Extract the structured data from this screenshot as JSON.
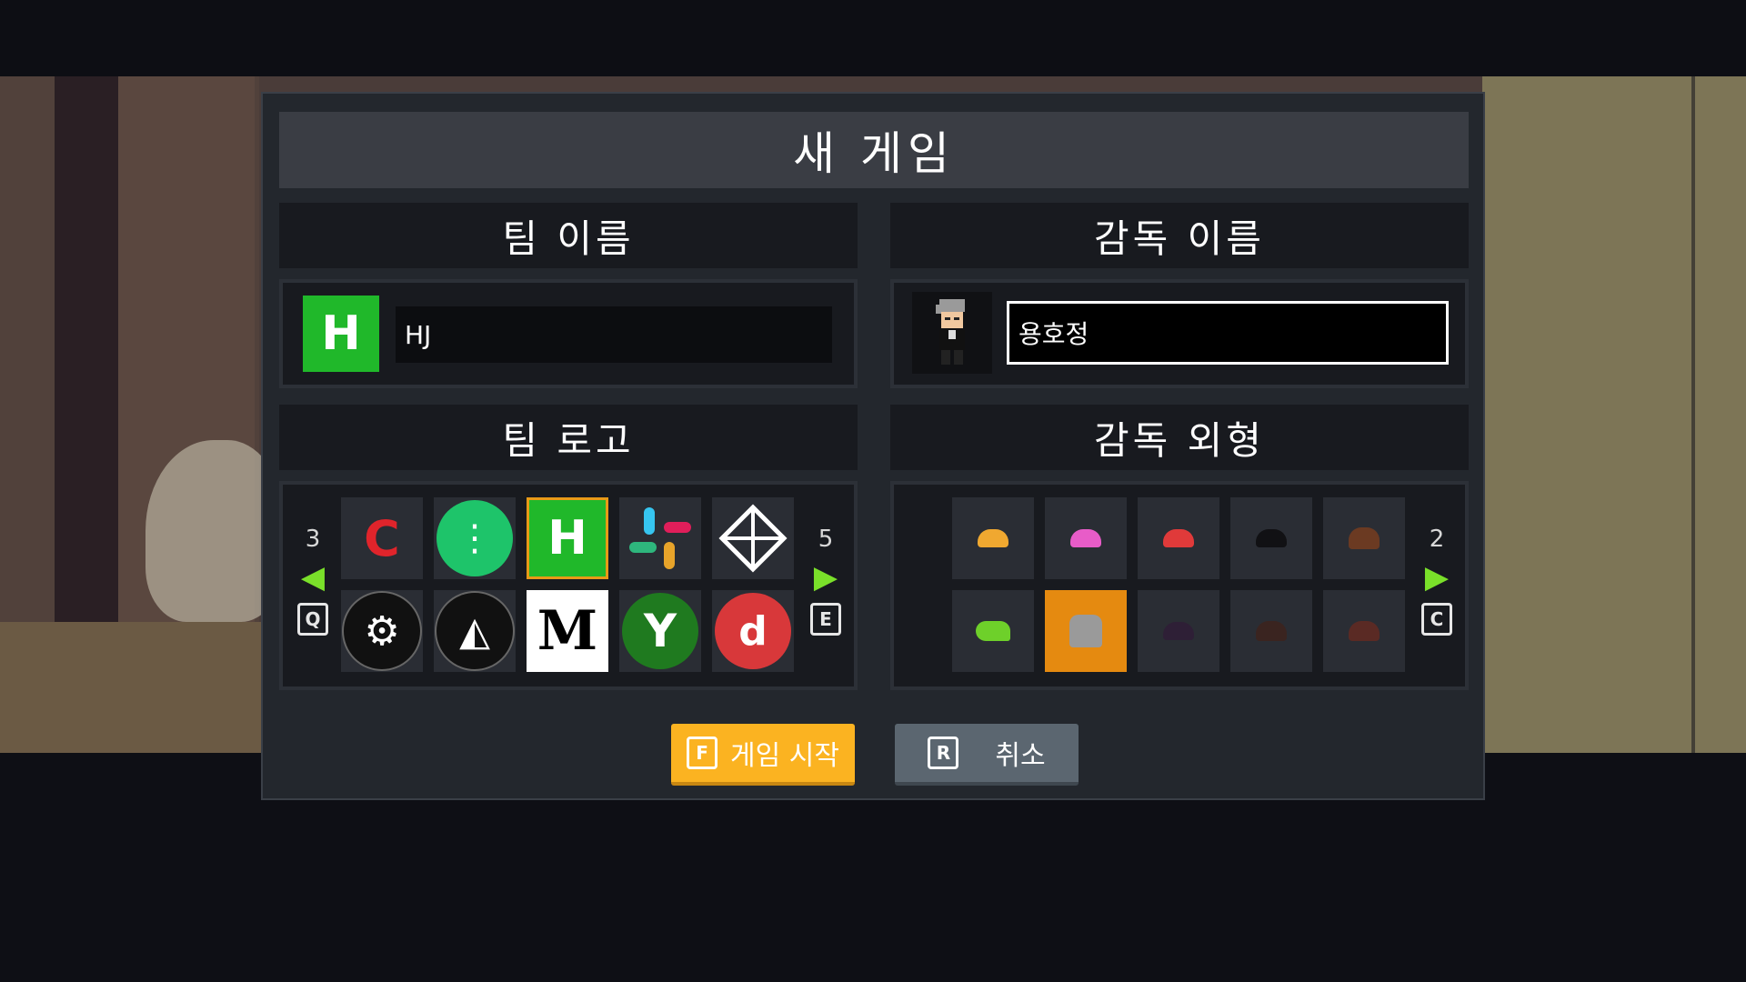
{
  "dialog": {
    "title": "새 게임",
    "team_name": {
      "header": "팀 이름",
      "icon_letter": "H",
      "value": "HJ"
    },
    "coach_name": {
      "header": "감독 이름",
      "value": "용호정"
    },
    "team_logo": {
      "header": "팀 로고",
      "prev_page": "3",
      "next_page": "5",
      "prev_key": "Q",
      "next_key": "E",
      "logos": [
        {
          "icon": "red-c-logo-icon",
          "glyph": "C",
          "color": "#e0242b"
        },
        {
          "icon": "green-circle-logo-icon",
          "glyph": "⋮",
          "color": "#1ec46a"
        },
        {
          "icon": "green-h-logo-icon",
          "glyph": "H",
          "color": "#20b82a",
          "selected": true
        },
        {
          "icon": "hashtag-logo-icon",
          "glyph": "#",
          "color": "#e8a42a"
        },
        {
          "icon": "triangle-logo-icon",
          "glyph": "◇",
          "color": "#ffffff"
        },
        {
          "icon": "gear-blade-logo-icon",
          "glyph": "⚙",
          "color": "#ffffff"
        },
        {
          "icon": "shark-logo-icon",
          "glyph": "◭",
          "color": "#ffffff"
        },
        {
          "icon": "m-logo-icon",
          "glyph": "M",
          "color": "#000000"
        },
        {
          "icon": "y-logo-icon",
          "glyph": "Y",
          "color": "#ffffff"
        },
        {
          "icon": "red-thumbs-logo-icon",
          "glyph": "d",
          "color": "#ffffff"
        }
      ]
    },
    "coach_look": {
      "header": "감독 외형",
      "next_page": "2",
      "next_key": "C",
      "looks": [
        {
          "icon": "blonde-hair-icon",
          "color": "#f0a830"
        },
        {
          "icon": "pink-hair-icon",
          "color": "#e85cc8"
        },
        {
          "icon": "red-hair-icon",
          "color": "#e03a3a"
        },
        {
          "icon": "black-hair-icon",
          "color": "#222226"
        },
        {
          "icon": "brown-hair-icon",
          "color": "#6b3a22"
        },
        {
          "icon": "green-hair-icon",
          "color": "#6ed02a"
        },
        {
          "icon": "grey-hair-icon",
          "color": "#9a9a9a",
          "selected": true
        },
        {
          "icon": "purple-hair-icon",
          "color": "#2e1f36"
        },
        {
          "icon": "dark-brown-hair-icon",
          "color": "#3a2420"
        },
        {
          "icon": "maroon-hair-icon",
          "color": "#5a2a24"
        }
      ]
    },
    "buttons": {
      "start_key": "F",
      "start_label": "게임 시작",
      "cancel_key": "R",
      "cancel_label": "취소"
    }
  }
}
